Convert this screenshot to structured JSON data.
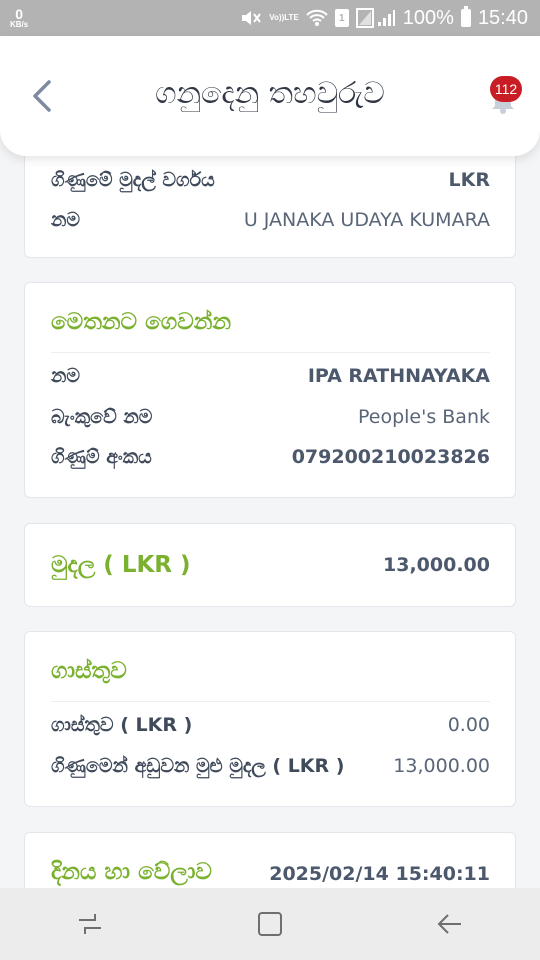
{
  "status_bar": {
    "speed_value": "0",
    "speed_unit": "KB/s",
    "volte_top": "Vo))",
    "volte_bottom": "LTE",
    "sim_slot": "1",
    "battery_percent": "100%",
    "time": "15:40"
  },
  "header": {
    "title": "ගනුදෙනු තහවුරුව",
    "notification_count": "112"
  },
  "account_card": {
    "rows": [
      {
        "label": "ගිණුමේ මුදල් වර්ගය",
        "value": "LKR"
      },
      {
        "label": "නම",
        "value": "U JANAKA UDAYA KUMARA"
      }
    ]
  },
  "recipient_card": {
    "title": "මෙතනට ගෙවන්න",
    "rows": [
      {
        "label": "නම",
        "value": "IPA RATHNAYAKA"
      },
      {
        "label": "බැංකුවේ නම",
        "value": "People's Bank"
      },
      {
        "label": "ගිණුම් අංකය",
        "value": "079200210023826"
      }
    ]
  },
  "amount_card": {
    "label": "මුදල ( LKR )",
    "value": "13,000.00"
  },
  "fee_card": {
    "title": "ගාස්තුව",
    "rows": [
      {
        "label": "ගාස්තුව ( LKR )",
        "value": "0.00"
      },
      {
        "label": "ගිණුමෙන් අඩුවන මුළු මුදල ( LKR )",
        "value": "13,000.00"
      }
    ]
  },
  "datetime_card": {
    "label": "දිනය හා වේලාව",
    "value": "2025/02/14 15:40:11"
  },
  "icons": {
    "back": "chevron-left-icon",
    "bell": "bell-icon",
    "nav_recent": "recent-apps-icon",
    "nav_home": "home-icon",
    "nav_back": "back-arrow-icon"
  },
  "colors": {
    "accent_green": "#7ab12e",
    "badge_red": "#c81d25",
    "status_bar": "#b3b3b3"
  }
}
